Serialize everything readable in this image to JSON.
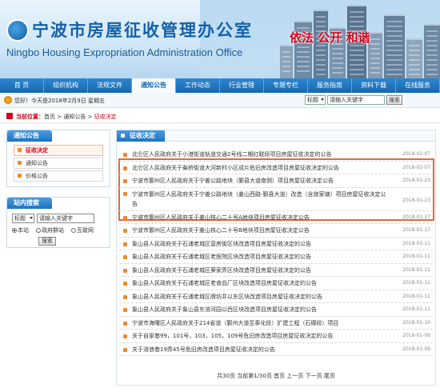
{
  "header": {
    "title_cn": "宁波市房屋征收管理办公室",
    "title_en": "Ningbo Housing Expropriation Administration Office",
    "slogan": "依法 公开 和谐"
  },
  "nav": {
    "items": [
      "首 页",
      "组织机构",
      "法规文件",
      "通知公告",
      "工作动态",
      "行业管理",
      "专题专栏",
      "服务指南",
      "资料下载",
      "在线服务"
    ],
    "active_index": 3
  },
  "infobar": {
    "date_text": "您好！今天是2018年2月9日 星期五",
    "search_scope": "标题",
    "search_placeholder": "请输入关键字",
    "search_button": "搜索"
  },
  "breadcrumb": {
    "label": "当前位置：",
    "path": "首页 > 通知公告 > ",
    "current": "征收决定"
  },
  "sidebar": {
    "notice_title": "通知公告",
    "items": [
      {
        "label": "征收决定",
        "active": true
      },
      {
        "label": "通知公告",
        "active": false
      },
      {
        "label": "价格公告",
        "active": false
      }
    ],
    "search_title": "站内搜索",
    "search_scope": "标题",
    "search_placeholder": "请输入关键字",
    "radios": [
      "本站",
      "政府群站",
      "互联网"
    ],
    "search_button": "搜索"
  },
  "main": {
    "section_title": "征收决定",
    "notices": [
      {
        "title": "北仑区人民政府关于小港街道轨道交通2号线二期红联段项目房屋征收决定的公告",
        "date": "2018-02-07"
      },
      {
        "title": "北仑区人民政府关于柴桥街道大河新村小区成片危旧房改造项目房屋征收决定的公告",
        "date": "2018-02-07"
      },
      {
        "title": "宁波市鄞州区人民政府关于宁姜公路地块（鄞县大道南侧）项目房屋征收决定公告",
        "date": "2018-01-23"
      },
      {
        "title": "宁波市鄞州区人民政府关于宁姜公路地块（姜山西路-鄞县大道）改造（含旅家塘）项目房屋征收决定公告",
        "date": "2018-01-23",
        "tall": true
      },
      {
        "title": "宁波市鄞州区人民政府关于姜山核心二十号A地块项目房屋征收决定公告",
        "date": "2018-01-17"
      },
      {
        "title": "宁波市鄞州区人民政府关于姜山核心二十号B地块项目房屋征收决定公告",
        "date": "2018-01-17"
      },
      {
        "title": "象山县人民政府关于石浦老城区营房街区块改造项目房屋征收决定的公告",
        "date": "2018-01-11"
      },
      {
        "title": "象山县人民政府关于石浦老城区老医院区块改造项目房屋征收决定的公告",
        "date": "2018-01-11"
      },
      {
        "title": "象山县人民政府关于石浦老城区葵家弄区块改造项目房屋征收决定的公告",
        "date": "2018-01-11"
      },
      {
        "title": "象山县人民政府关于石浦老城区老食品厂区块改造项目房屋征收决定的公告",
        "date": "2018-01-11"
      },
      {
        "title": "象山县人民政府关于石浦老城区牌坊井以东区块改造项目房屋征收决定的公告",
        "date": "2018-01-11"
      },
      {
        "title": "象山县人民政府关于象山县东溶河园以西区块改造项目房屋征收决定的公告",
        "date": "2018-01-11"
      },
      {
        "title": "宁波市海曙区人民政府关于214省道（鄞州大道至奉化段）扩建工程（石碶段）项目",
        "date": "2018-01-10"
      },
      {
        "title": "关于自家巷99，101号，103，105，109号危旧房改造项目房屋征收决定的公告",
        "date": "2018-01-09"
      },
      {
        "title": "关于溶浪巷19弄45号危旧房改造项目房屋征收决定的公告",
        "date": "2018-01-09"
      }
    ],
    "pager": "共30页 当前第1/30页 首页 上一页 下一页 尾页"
  }
}
